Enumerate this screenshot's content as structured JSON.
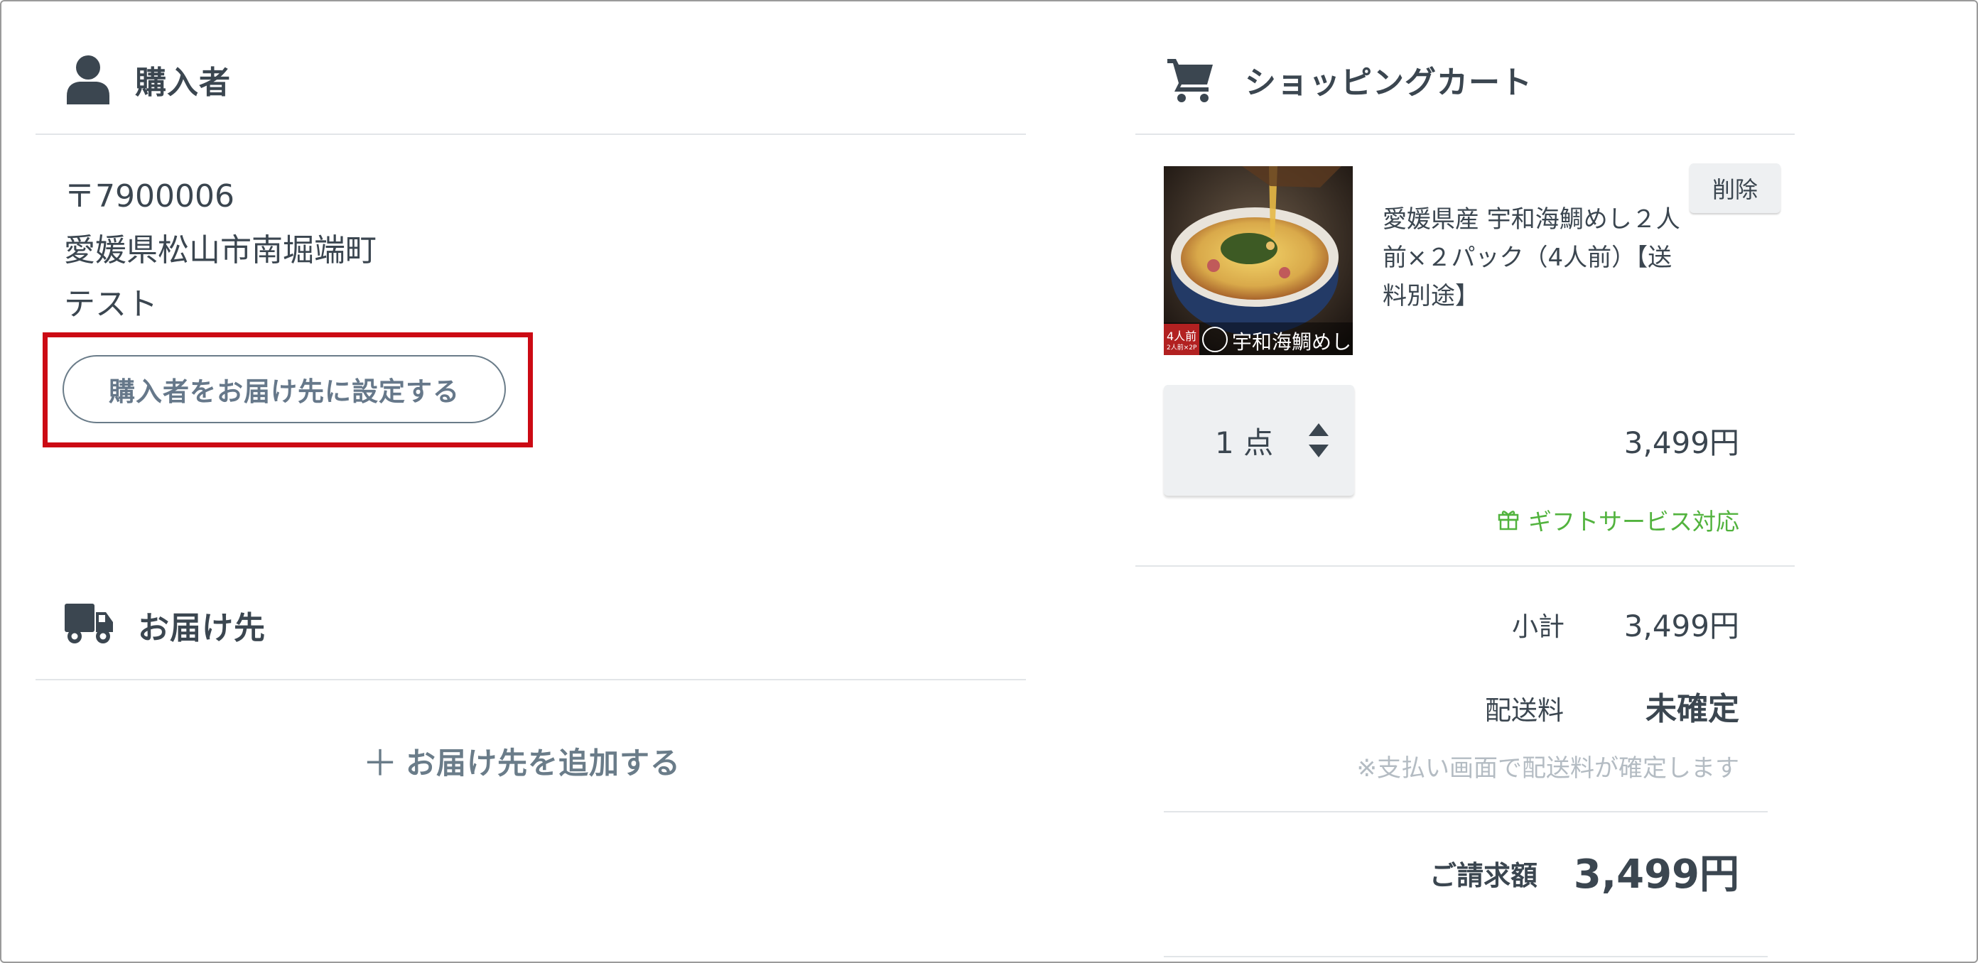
{
  "buyer": {
    "title": "購入者",
    "postal": "〒7900006",
    "city": "愛媛県松山市南堀端町",
    "name": "テスト",
    "set_as_recipient_label": "購入者をお届け先に設定する"
  },
  "delivery": {
    "title": "お届け先",
    "add_label": "お届け先を追加する"
  },
  "cart": {
    "title": "ショッピングカート",
    "item": {
      "image_caption": "宇和海鯛めし",
      "image_badge": "4人前",
      "image_badge_sub": "2人前×2P",
      "name": "愛媛県産 宇和海鯛めし２人前×２パック（4人前）【送料別途】",
      "delete_label": "削除",
      "quantity": "1 点",
      "price": "3,499円",
      "gift_service": "ギフトサービス対応"
    },
    "summary": {
      "subtotal_label": "小計",
      "subtotal_value": "3,499円",
      "shipping_label": "配送料",
      "shipping_value": "未確定",
      "shipping_note": "※支払い画面で配送料が確定します",
      "total_label": "ご請求額",
      "total_value": "3,499円"
    }
  },
  "colors": {
    "text": "#3b4650",
    "muted": "#6a7c89",
    "gift_green": "#52b33e",
    "highlight_red": "#cc0a14",
    "divider": "#e2e5e8"
  },
  "icons": {
    "buyer": "person-icon",
    "delivery": "truck-icon",
    "cart": "cart-icon",
    "gift": "gift-icon",
    "quantity": "sort-arrows-icon"
  }
}
